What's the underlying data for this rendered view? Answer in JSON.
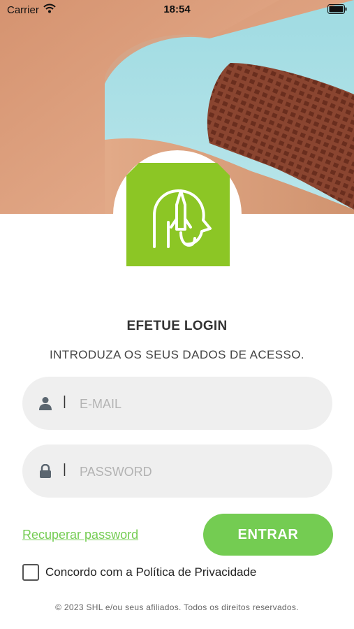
{
  "status_bar": {
    "carrier": "Carrier",
    "time": "18:54"
  },
  "header": {
    "logo_icon": "rocket-head-icon",
    "brand_color": "#8cc625"
  },
  "login": {
    "title": "EFETUE LOGIN",
    "subtitle": "INTRODUZA OS SEUS DADOS DE ACESSO.",
    "email": {
      "placeholder": "E-MAIL",
      "value": "",
      "icon": "user-icon"
    },
    "password": {
      "placeholder": "PASSWORD",
      "value": "",
      "icon": "lock-icon"
    },
    "separator": "|",
    "recover_label": "Recuperar password",
    "submit_label": "ENTRAR",
    "accent_color": "#74cc52",
    "consent_label": "Concordo com a Política de Privacidade",
    "consent_checked": false
  },
  "footer": {
    "copyright": "© 2023 SHL e/ou seus afiliados. Todos os direitos reservados."
  }
}
